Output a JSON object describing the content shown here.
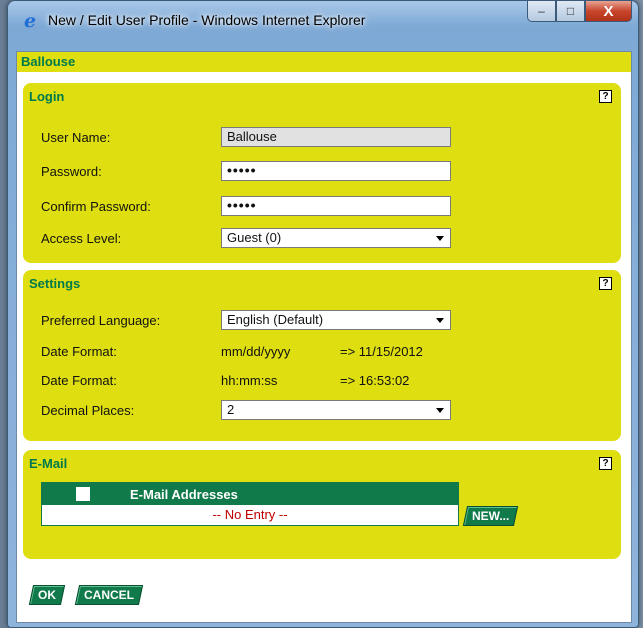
{
  "window": {
    "title": "New / Edit User Profile - Windows Internet Explorer",
    "icon": "ie-icon",
    "minimize_glyph": "–",
    "maximize_glyph": "□",
    "close_glyph": "X"
  },
  "header": {
    "title": "Ballouse"
  },
  "login": {
    "title": "Login",
    "help": "?",
    "username_label": "User Name:",
    "username_value": "Ballouse",
    "password_label": "Password:",
    "password_value": "•••••",
    "confirm_label": "Confirm Password:",
    "confirm_value": "•••••",
    "access_label": "Access Level:",
    "access_value": "Guest (0)"
  },
  "settings": {
    "title": "Settings",
    "help": "?",
    "language_label": "Preferred Language:",
    "language_value": "English (Default)",
    "date_label": "Date Format:",
    "date_format": "mm/dd/yyyy",
    "date_example": "=> 11/15/2012",
    "time_label": "Date Format:",
    "time_format": "hh:mm:ss",
    "time_example": "=> 16:53:02",
    "decimal_label": "Decimal Places:",
    "decimal_value": "2"
  },
  "email": {
    "title": "E-Mail",
    "help": "?",
    "column_header": "E-Mail Addresses",
    "empty_text": "-- No Entry --",
    "new_button": "NEW..."
  },
  "actions": {
    "ok": "OK",
    "cancel": "CANCEL"
  }
}
